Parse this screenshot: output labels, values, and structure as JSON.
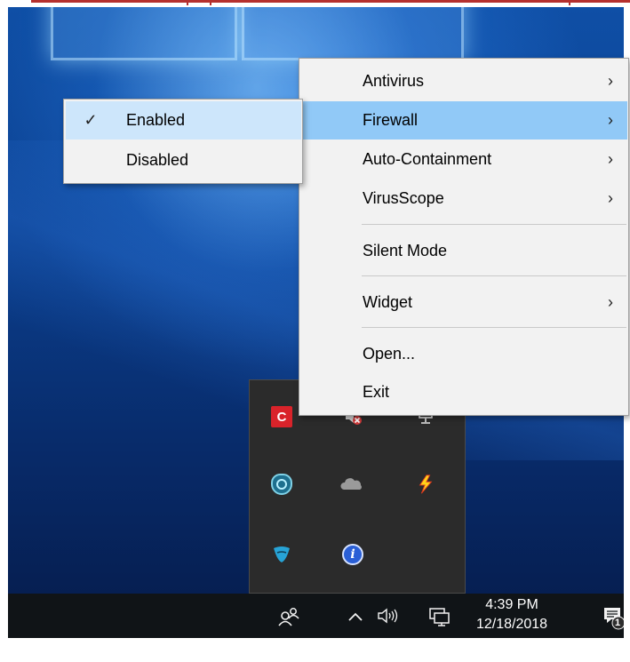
{
  "context_menu": {
    "items": [
      {
        "label": "Antivirus",
        "has_submenu": true
      },
      {
        "label": "Firewall",
        "has_submenu": true,
        "highlighted": true
      },
      {
        "label": "Auto-Containment",
        "has_submenu": true
      },
      {
        "label": "VirusScope",
        "has_submenu": true
      },
      {
        "label": "Silent Mode",
        "has_submenu": false
      },
      {
        "label": "Widget",
        "has_submenu": true
      },
      {
        "label": "Open...",
        "has_submenu": false
      },
      {
        "label": "Exit",
        "has_submenu": false
      }
    ],
    "submenu_arrow": "›"
  },
  "firewall_submenu": {
    "items": [
      {
        "label": "Enabled",
        "checked": true
      },
      {
        "label": "Disabled",
        "checked": false
      }
    ],
    "check_glyph": "✓"
  },
  "tray_flyout": {
    "icons": [
      "comodo-icon",
      "speaker-muted-icon",
      "network-icon",
      "shield-icon",
      "onedrive-cloud-icon",
      "lightning-icon",
      "eagle-icon",
      "info-icon"
    ],
    "comodo_glyph": "C",
    "info_glyph": "i"
  },
  "taskbar": {
    "time": "4:39 PM",
    "date": "12/18/2018",
    "notification_count": "1",
    "icons": [
      "people-icon",
      "chevron-up-icon",
      "volume-icon",
      "network-icon",
      "action-center-icon"
    ]
  },
  "colors": {
    "menu_bg": "#f2f2f2",
    "menu_highlight": "#91c9f7",
    "submenu_highlight": "#cde6fb",
    "taskbar_bg": "#101417",
    "frame_accent": "#b5302e"
  }
}
